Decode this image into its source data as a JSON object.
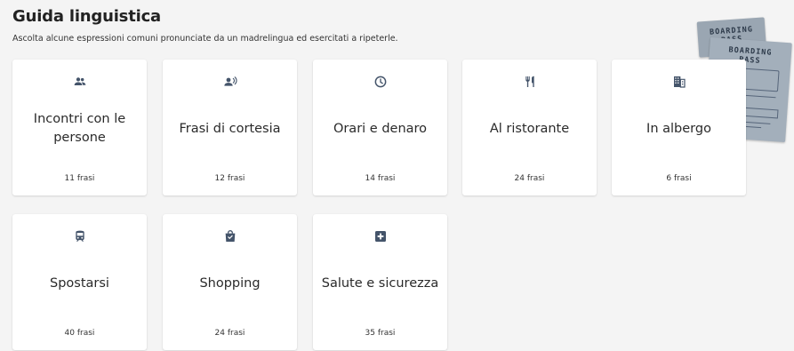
{
  "header": {
    "title": "Guida linguistica",
    "subtitle": "Ascolta alcune espressioni comuni pronunciate da un madrelingua ed esercitati a ripeterle."
  },
  "decoration": {
    "boarding_pass_line1": "BOARDING",
    "boarding_pass_line2": "PASS",
    "boarding_pass_line3": "BOARDING",
    "boarding_pass_line4": "PASS"
  },
  "categories": [
    {
      "label": "Incontri con le persone",
      "count": "11 frasi",
      "icon": "people-icon"
    },
    {
      "label": "Frasi di cortesia",
      "count": "12 frasi",
      "icon": "speaking-person-icon"
    },
    {
      "label": "Orari e denaro",
      "count": "14 frasi",
      "icon": "clock-icon"
    },
    {
      "label": "Al ristorante",
      "count": "24 frasi",
      "icon": "fork-knife-icon"
    },
    {
      "label": "In albergo",
      "count": "6 frasi",
      "icon": "building-icon"
    },
    {
      "label": "Spostarsi",
      "count": "40 frasi",
      "icon": "train-icon"
    },
    {
      "label": "Shopping",
      "count": "24 frasi",
      "icon": "shopping-bag-icon"
    },
    {
      "label": "Salute e sicurezza",
      "count": "35 frasi",
      "icon": "first-aid-icon"
    }
  ],
  "colors": {
    "icon": "#44546a",
    "background": "#f4f4f4",
    "card": "#ffffff"
  }
}
